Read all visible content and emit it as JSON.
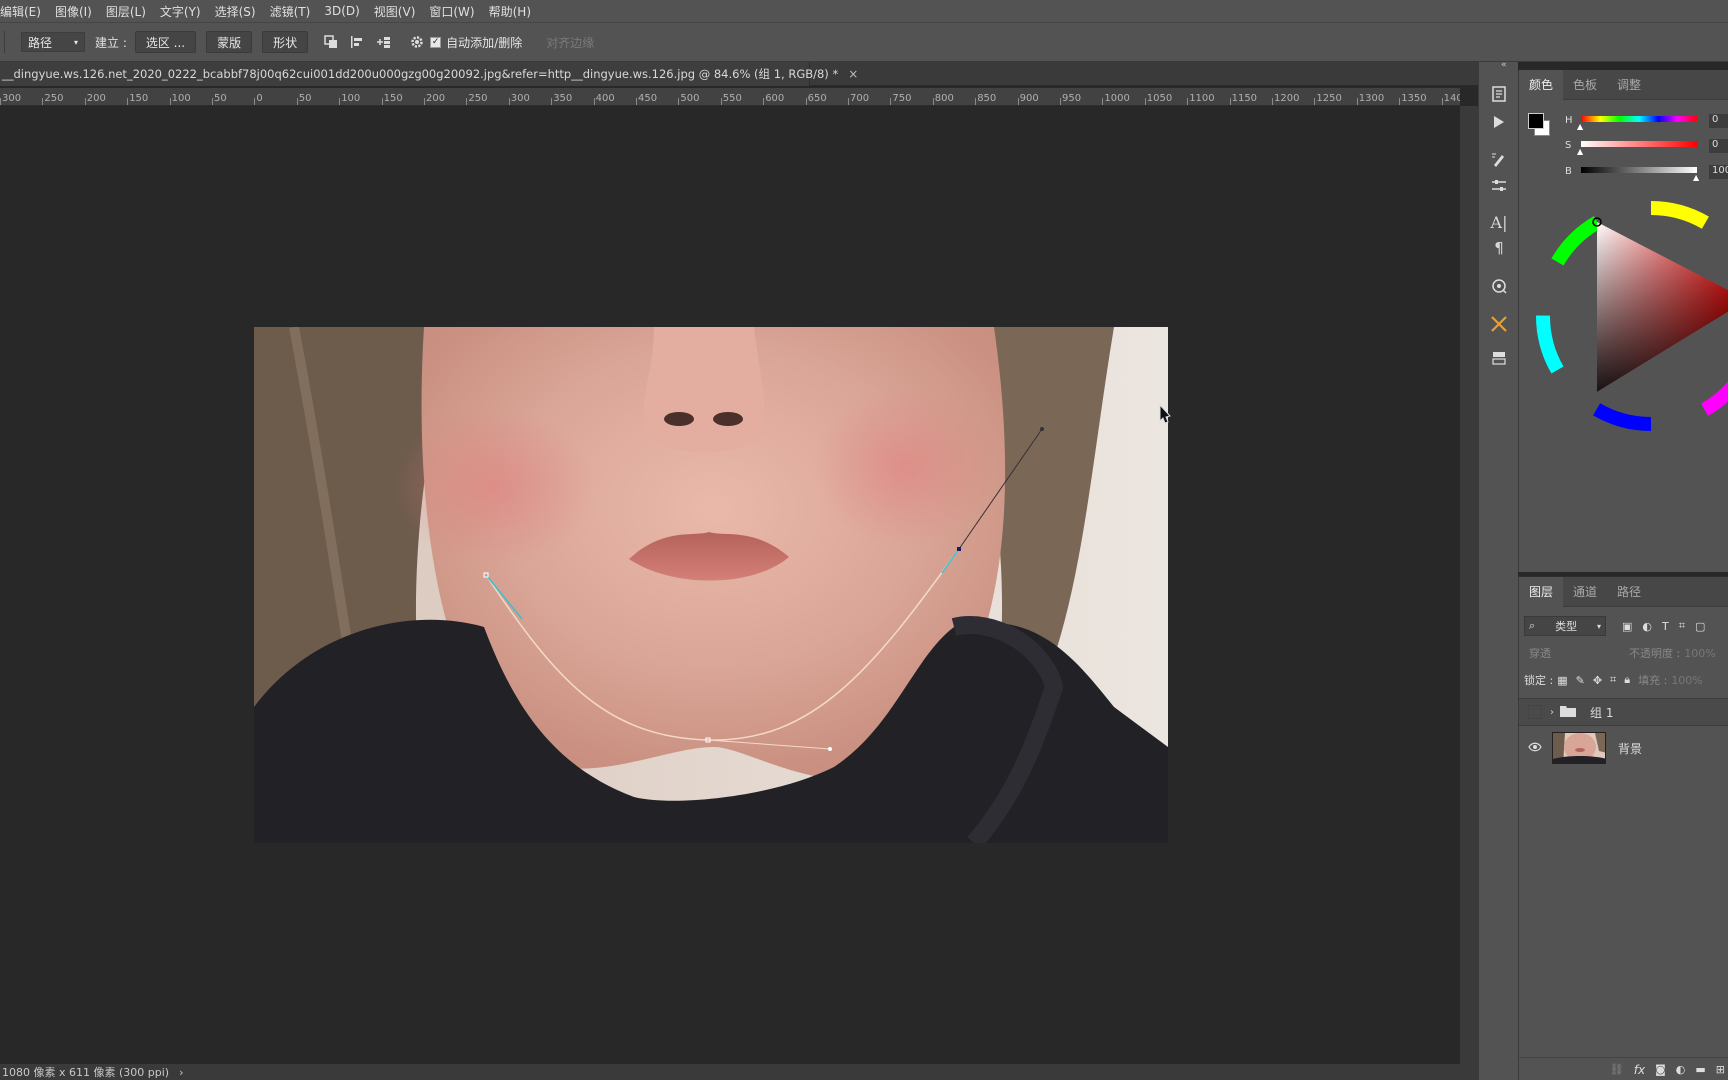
{
  "menubar": {
    "items": [
      "编辑(E)",
      "图像(I)",
      "图层(L)",
      "文字(Y)",
      "选择(S)",
      "滤镜(T)",
      "3D(D)",
      "视图(V)",
      "窗口(W)",
      "帮助(H)"
    ]
  },
  "options": {
    "mode_select": "路径",
    "build_label": "建立 :",
    "selection_btn": "选区 ...",
    "mask_btn": "蒙版",
    "shape_btn": "形状",
    "auto_add_delete": "自动添加/删除",
    "align_edges": "对齐边缘"
  },
  "document": {
    "tab_title": "__dingyue.ws.126.net_2020_0222_bcabbf78j00q62cui001dd200u000gzg00g20092.jpg&refer=http__dingyue.ws.126.jpg @ 84.6% (组 1, RGB/8) *",
    "close": "×"
  },
  "ruler": {
    "ticks": [
      "300",
      "250",
      "200",
      "150",
      "100",
      "50",
      "0",
      "50",
      "100",
      "150",
      "200",
      "250",
      "300",
      "350",
      "400",
      "450",
      "500",
      "550",
      "600",
      "650",
      "700",
      "750",
      "800",
      "850",
      "900",
      "950",
      "1000",
      "1050",
      "1100",
      "1150",
      "1200",
      "1250",
      "1300",
      "1350",
      "140"
    ]
  },
  "status": {
    "text": "1080 像素 x 611 像素 (300 ppi)",
    "arrow": "›"
  },
  "color_panel": {
    "tabs": [
      "颜色",
      "色板",
      "调整"
    ],
    "h_label": "H",
    "s_label": "S",
    "b_label": "B",
    "h_value": "0",
    "s_value": "0",
    "b_value": "100",
    "foreground": "#000000",
    "background": "#ffffff"
  },
  "layers_panel": {
    "tabs": [
      "图层",
      "通道",
      "路径"
    ],
    "filter_select": "类型",
    "blend_mode": "穿透",
    "opacity_label": "不透明度 :",
    "opacity_value": "100%",
    "lock_label": "锁定 :",
    "fill_label": "填充 :",
    "fill_value": "100%",
    "layers": [
      {
        "name": "组 1",
        "type": "group",
        "visible": false
      },
      {
        "name": "背景",
        "type": "image",
        "visible": true
      }
    ]
  }
}
